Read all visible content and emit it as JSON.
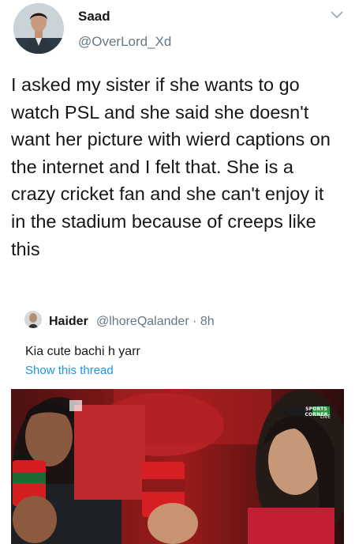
{
  "tweet": {
    "display_name": "Saad",
    "handle": "@OverLord_Xd",
    "text": "I asked my sister if she wants to go watch PSL and she said she doesn't want her picture with wierd captions on the internet and I felt that. She is a crazy cricket fan and she can't enjoy it in the stadium because of creeps like this",
    "menu_icon": "chevron-down-icon"
  },
  "quoted": {
    "display_name": "Haider",
    "handle_time": "@lhoreQalander · 8h",
    "text": "Kia cute bachi h yarr",
    "show_thread": "Show this thread"
  },
  "photo": {
    "overlay_title": "SPORTS CORNER",
    "overlay_sub": "LIVE"
  },
  "colors": {
    "text": "#14171a",
    "muted": "#657786",
    "link": "#1b95e0"
  }
}
